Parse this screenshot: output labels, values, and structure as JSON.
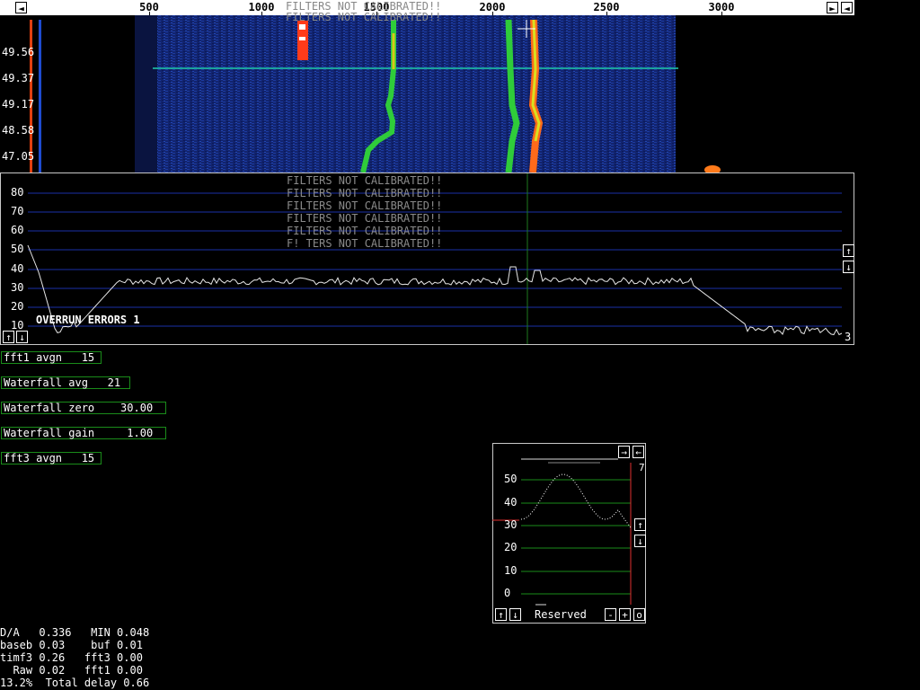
{
  "topbar": {
    "left_icon": "arrow-left-icon",
    "right_icons": [
      "arrow-right-icon",
      "arrow-left-icon"
    ],
    "freq_labels": [
      "500",
      "1000",
      "1500",
      "2000",
      "2500",
      "3000"
    ]
  },
  "waterfall": {
    "time_labels": [
      "49.56",
      "49.37",
      "49.17",
      "48.58",
      "47.05"
    ],
    "filters_warning": "FILTERS NOT CALIBRATED!!"
  },
  "spectrum": {
    "y_labels": [
      "80",
      "70",
      "60",
      "50",
      "40",
      "30",
      "20",
      "10"
    ],
    "warnings": [
      "FILTERS NOT CALIBRATED!!",
      "FILTERS NOT CALIBRATED!!",
      "FILTERS NOT CALIBRATED!!",
      "FILTERS NOT CALIBRATED!!",
      "FILTERS NOT CALIBRATED!!",
      "F! TERS NOT CALIBRATED!!"
    ],
    "overrun": "OVERRUN ERRORS 1",
    "right_value": "3",
    "up_icon": "arrow-up-icon",
    "down_icon": "arrow-down-icon"
  },
  "params": [
    {
      "label": "fft1 avgn   15"
    },
    {
      "label": "Waterfall avg   21"
    },
    {
      "label": "Waterfall zero    30.00"
    },
    {
      "label": "Waterfall gain     1.00"
    },
    {
      "label": "fft3 avgn   15"
    }
  ],
  "smallwin": {
    "y_labels": [
      "50",
      "40",
      "30",
      "20",
      "10",
      "0"
    ],
    "corner_value": "7",
    "reserved": "Reserved",
    "minus": "-",
    "plus": "+",
    "o_label": "o"
  },
  "stats": [
    "D/A   0.336   MIN 0.048",
    "baseb 0.03    buf 0.01",
    "timf3 0.26   fft3 0.00",
    "  Raw 0.02   fft1 0.00",
    "13.2%  Total delay 0.66"
  ],
  "colors": {
    "grid_blue": "#1a2fa8",
    "grid_green": "#1a8c1a",
    "box_green": "#1a8c1a",
    "marker_green": "#1e7a1e"
  }
}
